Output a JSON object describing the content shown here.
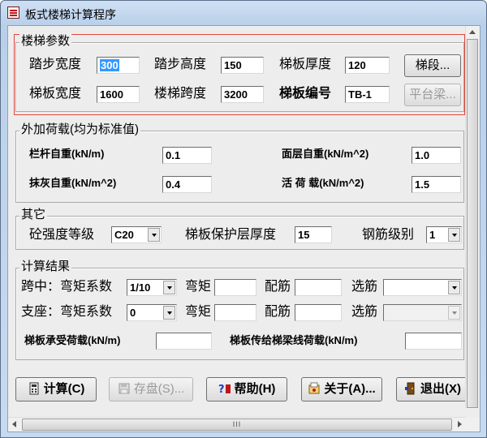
{
  "window": {
    "title": "板式楼梯计算程序"
  },
  "stair_params": {
    "legend": "楼梯参数",
    "tread_width_label": "踏步宽度",
    "tread_width_value": "300",
    "tread_height_label": "踏步高度",
    "tread_height_value": "150",
    "slab_thickness_label": "梯板厚度",
    "slab_thickness_value": "120",
    "segment_button": "梯段...",
    "slab_width_label": "梯板宽度",
    "slab_width_value": "1600",
    "span_label": "楼梯跨度",
    "span_value": "3200",
    "slab_id_label": "梯板编号",
    "slab_id_value": "TB-1",
    "landing_beam_button": "平台梁..."
  },
  "loads": {
    "legend": "外加荷载(均为标准值)",
    "railing_label": "栏杆自重(kN/m)",
    "railing_value": "0.1",
    "surface_label": "面层自重(kN/m^2)",
    "surface_value": "1.0",
    "plaster_label": "抹灰自重(kN/m^2)",
    "plaster_value": "0.4",
    "live_label": "活  荷  载(kN/m^2)",
    "live_value": "1.5"
  },
  "other": {
    "legend": "其它",
    "concrete_label": "砼强度等级",
    "concrete_value": "C20",
    "cover_label": "梯板保护层厚度",
    "cover_value": "15",
    "rebar_label": "钢筋级别",
    "rebar_value": "1"
  },
  "results": {
    "legend": "计算结果",
    "midspan_label": "跨中：弯矩系数",
    "midspan_coef": "1/10",
    "support_label": "支座：弯矩系数",
    "support_coef": "0",
    "moment_label": "弯矩",
    "reinf_label": "配筋",
    "select_label": "选筋",
    "slab_load_label": "梯板承受荷载(kN/m)",
    "beam_load_label": "梯板传给梯梁线荷载(kN/m)"
  },
  "buttons": {
    "calc": "计算(C)",
    "save": "存盘(S)...",
    "help": "帮助(H)",
    "about": "关于(A)...",
    "exit": "退出(X)"
  },
  "scroll": {
    "h_grip": "III"
  }
}
